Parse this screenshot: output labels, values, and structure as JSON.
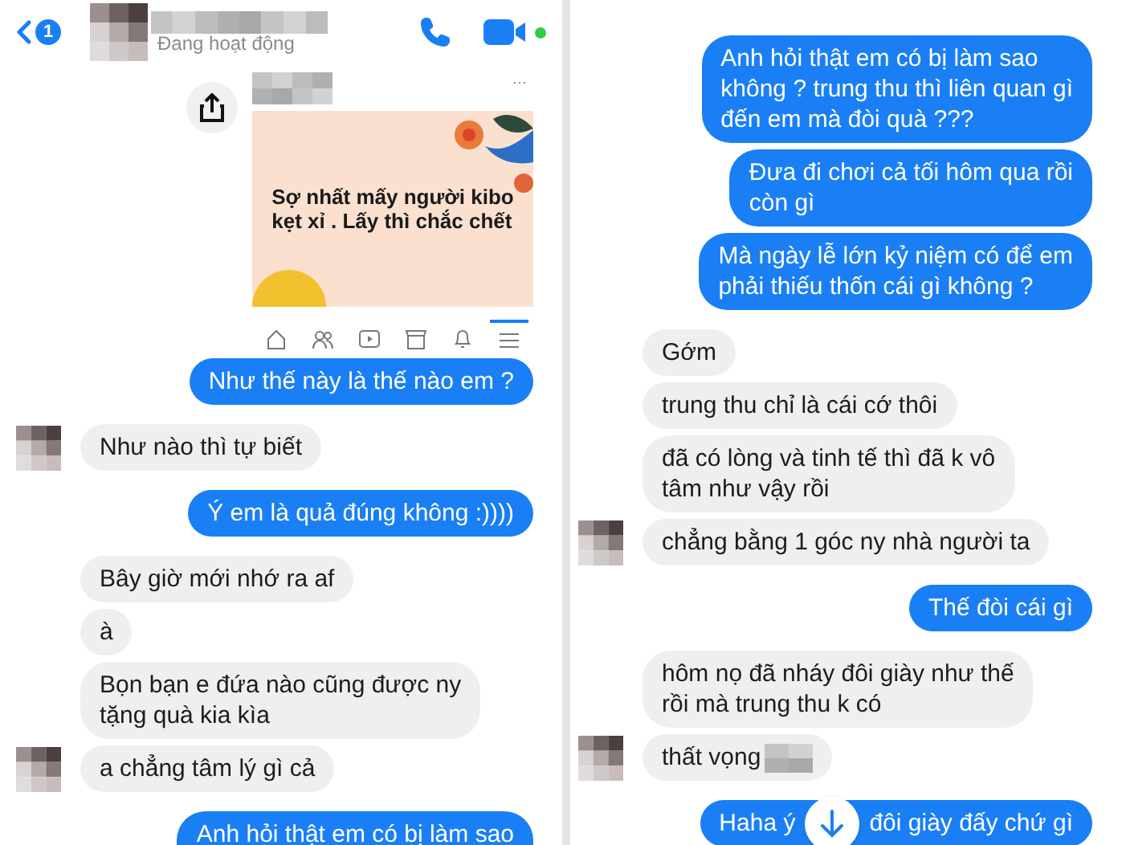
{
  "left_panel": {
    "header": {
      "unread_count": "1",
      "status": "Đang hoạt động",
      "call_online": true
    },
    "shared_post": {
      "text": "Sợ nhất mấy người kibo\nkẹt xỉ . Lấy thì chắc chết",
      "more": "···"
    },
    "post_nav": [
      {
        "kind": "home",
        "selected": false
      },
      {
        "kind": "friends",
        "selected": false
      },
      {
        "kind": "video",
        "selected": false
      },
      {
        "kind": "store",
        "selected": false
      },
      {
        "kind": "bell",
        "selected": false
      },
      {
        "kind": "menu",
        "selected": true
      }
    ],
    "messages": [
      {
        "outgoing": true,
        "text": "Như thế này là thế nào em ?"
      },
      {
        "outgoing": false,
        "text": "Như nào thì tự biết",
        "avatar": true
      },
      {
        "outgoing": true,
        "text": "Ý em là quả đúng không :))))"
      },
      {
        "outgoing": false,
        "text": "Bây giờ mới nhớ ra af",
        "avatar": false
      },
      {
        "outgoing": false,
        "text": "à",
        "avatar": false
      },
      {
        "outgoing": false,
        "text": "Bọn bạn e đứa nào cũng được ny\ntặng quà kia kìa",
        "avatar": false
      },
      {
        "outgoing": false,
        "text": "a chẳng tâm lý gì cả",
        "avatar": true
      },
      {
        "outgoing": true,
        "text": "Anh hỏi thật em có bị làm sao",
        "cut": true
      }
    ]
  },
  "right_panel": {
    "messages": [
      {
        "outgoing": true,
        "text": "Anh hỏi thật em có bị làm sao\nkhông ? trung thu thì liên quan gì\nđến em mà đòi quà ???"
      },
      {
        "outgoing": true,
        "text": "Đưa đi chơi cả tối hôm qua rồi\ncòn gì"
      },
      {
        "outgoing": true,
        "text": "Mà ngày lễ lớn kỷ niệm có để em\nphải thiếu thốn cái gì không ?"
      },
      {
        "outgoing": false,
        "text": "Gớm",
        "avatar": false
      },
      {
        "outgoing": false,
        "text": "trung thu chỉ là cái cớ thôi",
        "avatar": false
      },
      {
        "outgoing": false,
        "text": "đã có lòng và tinh tế thì đã k vô\ntâm như vậy rồi",
        "avatar": false
      },
      {
        "outgoing": false,
        "text": "chẳng bằng 1 góc ny nhà người ta",
        "avatar": true
      },
      {
        "outgoing": true,
        "text": "Thế đòi cái gì"
      },
      {
        "outgoing": false,
        "text": "hôm nọ đã nháy đôi giày như thế\nrồi mà trung thu k có",
        "avatar": false
      },
      {
        "outgoing": false,
        "text": "thất vọng",
        "avatar": true,
        "blurred_emoji": true
      },
      {
        "outgoing": true,
        "text": "Haha ý",
        "text_after": "đôi giày đấy chứ gì",
        "scroll_button": true
      }
    ]
  }
}
